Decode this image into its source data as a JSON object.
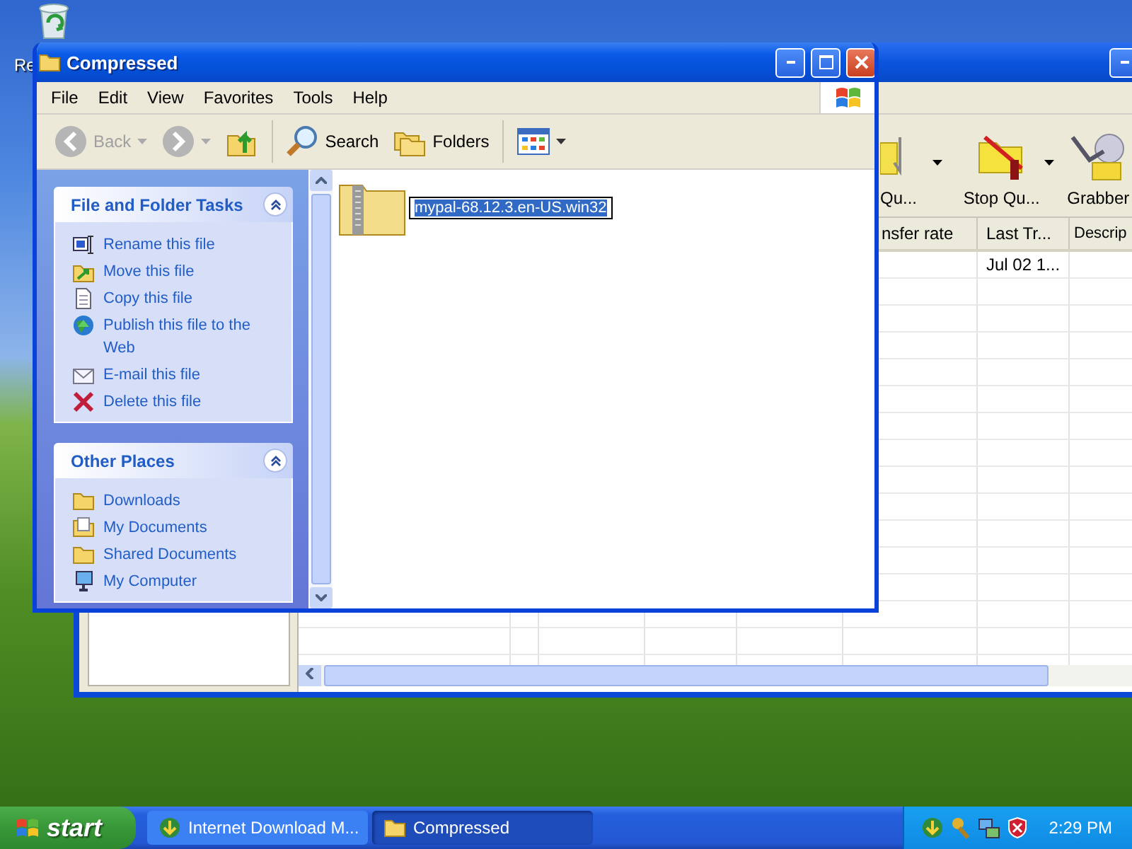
{
  "desktop": {
    "icons": [
      {
        "label": "Re"
      }
    ]
  },
  "background_window": {
    "toolbar": [
      {
        "kind": "queue",
        "label": "Qu..."
      },
      {
        "kind": "stop-queue",
        "label": "Stop Qu..."
      },
      {
        "kind": "grabber",
        "label": "Grabber"
      }
    ],
    "table": {
      "columns": [
        {
          "label": "nsfer rate"
        },
        {
          "label": "Last Tr...",
          "cells": [
            "Jul 02 1..."
          ]
        },
        {
          "label": "Descrip"
        }
      ]
    }
  },
  "window": {
    "title": "Compressed",
    "menu": [
      "File",
      "Edit",
      "View",
      "Favorites",
      "Tools",
      "Help"
    ],
    "toolbar": [
      {
        "kind": "back",
        "label": "Back",
        "disabled": true
      },
      {
        "kind": "forward",
        "disabled": true
      },
      {
        "kind": "up",
        "disabled": false
      },
      {
        "kind": "search",
        "label": "Search",
        "disabled": false
      },
      {
        "kind": "folders",
        "label": "Folders",
        "disabled": false
      },
      {
        "kind": "views",
        "disabled": false
      }
    ],
    "task_panes": [
      {
        "title": "File and Folder Tasks",
        "expanded": true,
        "items": [
          {
            "kind": "rename",
            "label": "Rename this file"
          },
          {
            "kind": "move",
            "label": "Move this file"
          },
          {
            "kind": "copy",
            "label": "Copy this file"
          },
          {
            "kind": "publish",
            "label": "Publish this file to the Web"
          },
          {
            "kind": "email",
            "label": "E-mail this file"
          },
          {
            "kind": "delete",
            "label": "Delete this file"
          }
        ]
      },
      {
        "title": "Other Places",
        "expanded": true,
        "items": [
          {
            "kind": "folder",
            "label": "Downloads"
          },
          {
            "kind": "documents",
            "label": "My Documents"
          },
          {
            "kind": "folder",
            "label": "Shared Documents"
          },
          {
            "kind": "computer",
            "label": "My Computer"
          }
        ]
      }
    ],
    "files": [
      {
        "name": "mypal-68.12.3.en-US.win32",
        "renaming": true
      }
    ]
  },
  "taskbar": {
    "start": "start",
    "tasks": [
      {
        "kind": "idm",
        "label": "Internet Download M...",
        "selected": false
      },
      {
        "kind": "folder",
        "label": "Compressed",
        "selected": true
      }
    ],
    "clock": "2:29 PM"
  }
}
